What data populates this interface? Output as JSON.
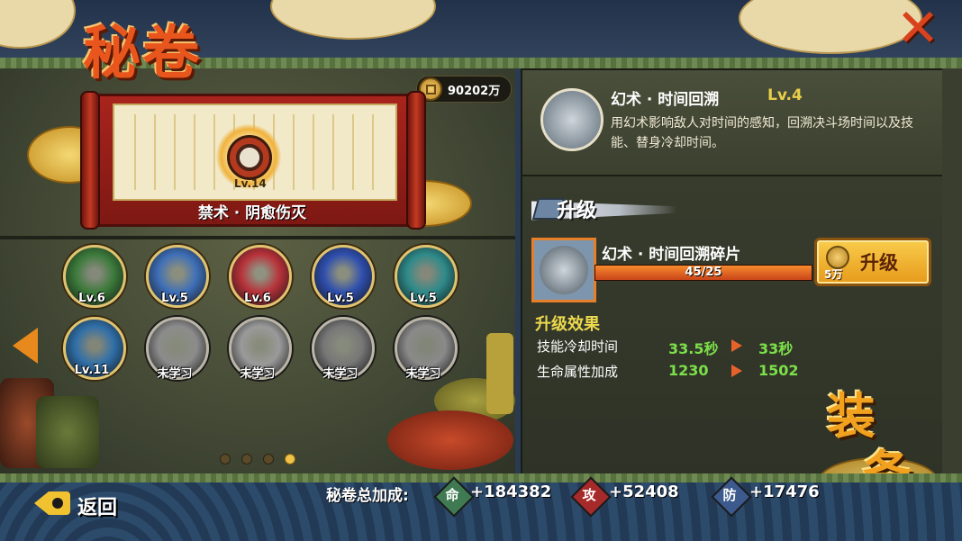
{
  "header": {
    "title": "秘卷",
    "close_icon": "close-x-icon"
  },
  "currency": {
    "icon": "coin-icon",
    "amount": "90202万"
  },
  "featured_scroll": {
    "level": "Lv.14",
    "name": "禁术 · 阴愈伤灭"
  },
  "skills": [
    {
      "level": "Lv.6",
      "color": "#3b7a3a"
    },
    {
      "level": "Lv.5",
      "color": "#3e6fb8"
    },
    {
      "level": "Lv.6",
      "color": "#b8323a"
    },
    {
      "level": "Lv.5",
      "color": "#2f4fae"
    },
    {
      "level": "Lv.5",
      "color": "#2e8a8a"
    },
    {
      "level": "Lv.11",
      "color": "#2f6fa8"
    },
    {
      "level": "未学习",
      "color": "#8c8c8c"
    },
    {
      "level": "未学习",
      "color": "#9a9a9a"
    },
    {
      "level": "未学习",
      "color": "#777777"
    },
    {
      "level": "未学习",
      "color": "#8a8a8a"
    }
  ],
  "pagination": {
    "pages": 4,
    "active": 4
  },
  "detail": {
    "skill_name": "幻术 · 时间回溯",
    "skill_level": "Lv.4",
    "description": "用幻术影响敌人对时间的感知，回溯决斗场时间以及技能、替身冷却时间。",
    "upgrade_header": "升级",
    "fragment_name": "幻术 · 时间回溯碎片",
    "fragment_progress": "45/25",
    "fragment_fill": 1.0,
    "upgrade_button": {
      "cost": "5万",
      "label": "升级"
    },
    "effect_title": "升级效果",
    "effects": [
      {
        "label": "技能冷却时间",
        "old": "33.5秒",
        "new": "33秒"
      },
      {
        "label": "生命属性加成",
        "old": "1230",
        "new": "1502"
      }
    ]
  },
  "equip_label": [
    "装",
    "备"
  ],
  "footer": {
    "back_label": "返回",
    "total_label": "秘卷总加成:",
    "totals": [
      {
        "badge": "命",
        "value": "+184382",
        "color": "#3f7a52"
      },
      {
        "badge": "攻",
        "value": "+52408",
        "color": "#a62a2a"
      },
      {
        "badge": "防",
        "value": "+17476",
        "color": "#3d5a8e"
      }
    ]
  }
}
